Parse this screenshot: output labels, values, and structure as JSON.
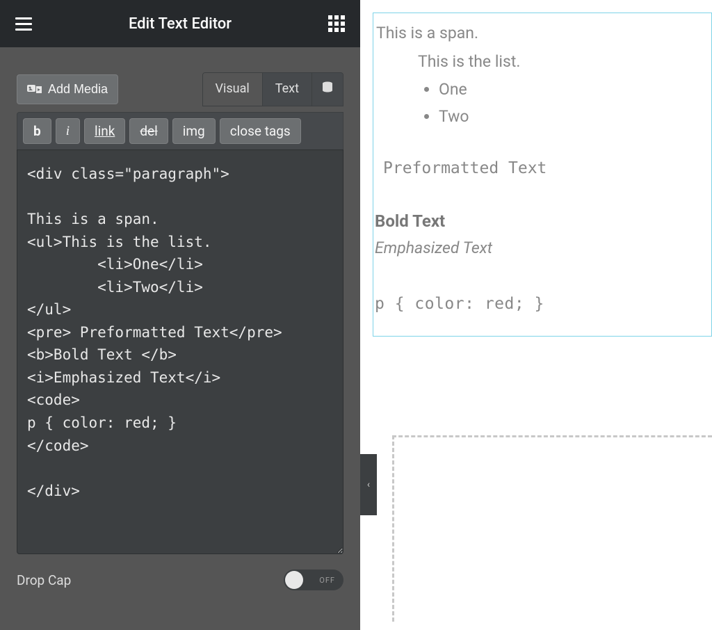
{
  "header": {
    "title": "Edit Text Editor"
  },
  "toolbar": {
    "add_media_label": "Add Media",
    "tabs": {
      "visual": "Visual",
      "text": "Text"
    },
    "fmt": {
      "bold": "b",
      "italic": "i",
      "link": "link",
      "del": "del",
      "img": "img",
      "close_tags": "close tags"
    }
  },
  "editor": {
    "content": "<div class=\"paragraph\">\n\nThis is a span.\n<ul>This is the list.\n        <li>One</li>\n        <li>Two</li>\n</ul>\n<pre> Preformatted Text</pre>\n<b>Bold Text </b>\n<i>Emphasized Text</i>\n<code>\np { color: red; }\n</code>\n\n</div>"
  },
  "settings": {
    "drop_cap_label": "Drop Cap",
    "toggle_off": "OFF"
  },
  "preview": {
    "span_text": "This is a span.",
    "list_intro": "This is the list.",
    "list_items": [
      "One",
      "Two"
    ],
    "preformatted": "Preformatted Text",
    "bold": "Bold Text",
    "emphasized": "Emphasized Text",
    "code": "p { color: red; }"
  }
}
